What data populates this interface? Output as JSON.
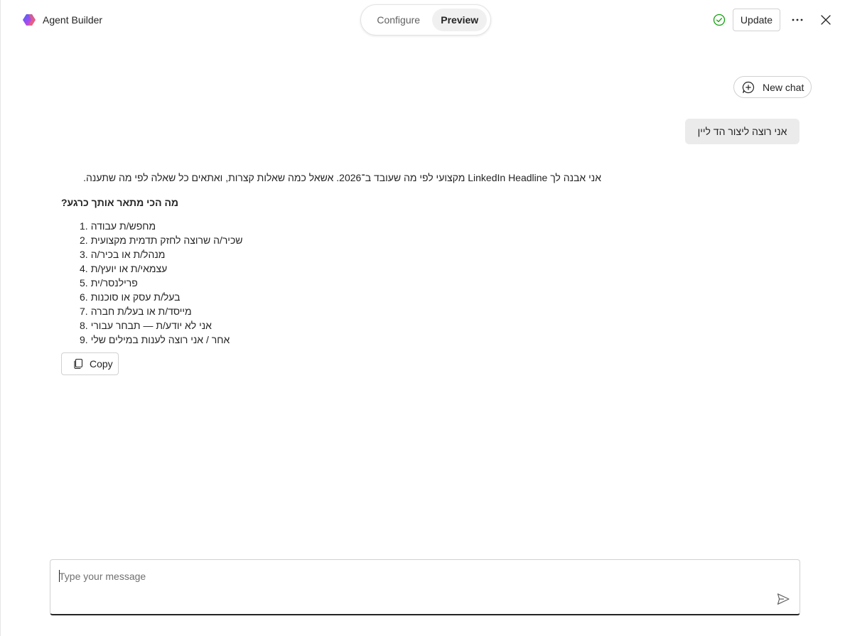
{
  "header": {
    "app_title": "Agent Builder",
    "tabs": [
      {
        "label": "Configure",
        "selected": false
      },
      {
        "label": "Preview",
        "selected": true
      }
    ],
    "status_icon": "check-circle-icon",
    "update_label": "Update",
    "more_icon": "more-horizontal-icon",
    "close_icon": "close-icon"
  },
  "chat": {
    "new_chat_label": "New chat",
    "user_message": "אני רוצה ליצור הד ליין",
    "assistant": {
      "intro": "אני אבנה לך LinkedIn Headline מקצועי לפי מה שעובד ב־2026. אשאל כמה שאלות קצרות, ואתאים כל שאלה לפי מה שתענה.",
      "question": "מה הכי מתאר אותך כרגע?",
      "options": [
        {
          "num": "1.",
          "text": "מחפש/ת עבודה"
        },
        {
          "num": "2.",
          "text": "שכיר/ה שרוצה לחזק תדמית מקצועית"
        },
        {
          "num": "3.",
          "text": "מנהל/ת או בכיר/ה"
        },
        {
          "num": "4.",
          "text": "עצמאי/ת או יועץ/ת"
        },
        {
          "num": "5.",
          "text": "פרילנסר/ית"
        },
        {
          "num": "6.",
          "text": "בעל/ת עסק או סוכנות"
        },
        {
          "num": "7.",
          "text": "מייסד/ת או בעל/ת חברה"
        },
        {
          "num": "8.",
          "text": "אני לא יודע/ת — תבחר עבורי"
        },
        {
          "num": "9.",
          "text": "אחר / אני רוצה לענות במילים שלי"
        }
      ],
      "copy_label": "Copy"
    }
  },
  "composer": {
    "placeholder": "Type your message",
    "value": "",
    "send_icon": "send-icon"
  },
  "colors": {
    "success": "#13a10e",
    "user_bubble": "#ebebeb",
    "text": "#242424"
  }
}
